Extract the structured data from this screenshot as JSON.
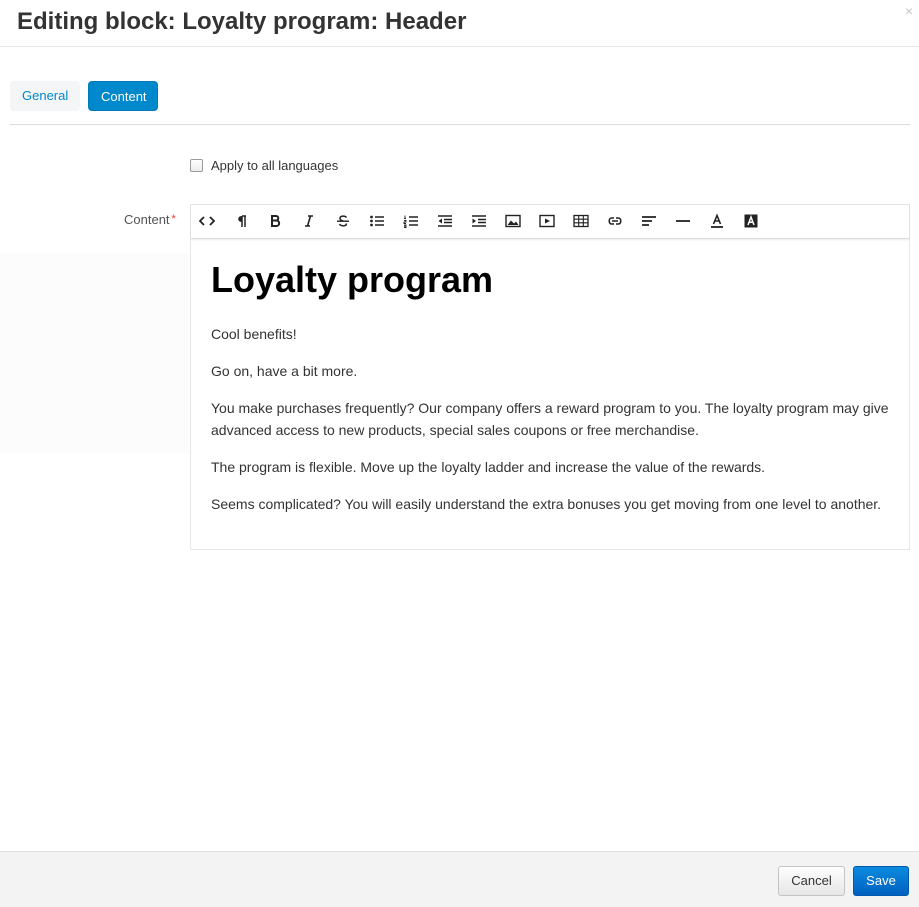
{
  "dialog": {
    "title": "Editing block: Loyalty program: Header",
    "close_symbol": "×"
  },
  "tabs": [
    {
      "label": "General",
      "active": false
    },
    {
      "label": "Content",
      "active": true
    }
  ],
  "apply_all": {
    "label": "Apply to all languages",
    "checked": false
  },
  "content_field": {
    "label": "Content",
    "required_marker": "*"
  },
  "toolbar": {
    "buttons": [
      "html-icon",
      "paragraph-icon",
      "bold-icon",
      "italic-icon",
      "strikethrough-icon",
      "bullet-list-icon",
      "numbered-list-icon",
      "outdent-icon",
      "indent-icon",
      "image-icon",
      "video-icon",
      "table-icon",
      "link-icon",
      "align-icon",
      "horizontal-rule-icon",
      "font-color-icon",
      "background-color-icon"
    ]
  },
  "content": {
    "heading": "Loyalty program",
    "paragraphs": [
      "Cool benefits!",
      "Go on, have a bit more.",
      "You make purchases frequently? Our company offers a reward program to you. The loyalty program may give advanced access to new products, special sales coupons or free merchandise.",
      "The program is flexible. Move up the loyalty ladder and increase the value of the rewards.",
      "Seems complicated? You will easily understand the extra bonuses you get moving from one level to another."
    ]
  },
  "footer": {
    "cancel_label": "Cancel",
    "save_label": "Save"
  },
  "colors": {
    "accent": "#0088cc",
    "save": "#0a74d6",
    "required": "#ee3333"
  }
}
